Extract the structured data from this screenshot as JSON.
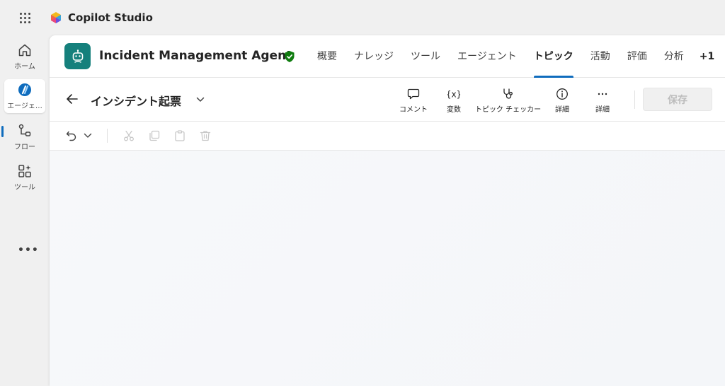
{
  "app": {
    "name": "Copilot Studio"
  },
  "rail": {
    "items": [
      {
        "label": "ホーム",
        "icon": "home-icon"
      },
      {
        "label": "エージェ…",
        "icon": "agents-icon",
        "active": true
      },
      {
        "label": "フロー",
        "icon": "flow-icon"
      },
      {
        "label": "ツール",
        "icon": "tools-icon"
      }
    ],
    "more": "•••"
  },
  "agent": {
    "name": "Incident Management Agent",
    "tabs": [
      "概要",
      "ナレッジ",
      "ツール",
      "エージェント",
      "トピック",
      "活動",
      "評価",
      "分析"
    ],
    "active_tab": "トピック",
    "overflow": "+1"
  },
  "topic": {
    "title": "インシデント起票",
    "tools": {
      "comment": "コメント",
      "variables": "変数",
      "checker": "トピック チェッカー",
      "details": "詳細",
      "more": "詳細"
    },
    "save": "保存"
  },
  "colors": {
    "accent": "#0f6cbd",
    "agent_avatar": "#15807c",
    "shield": "#107c10"
  }
}
